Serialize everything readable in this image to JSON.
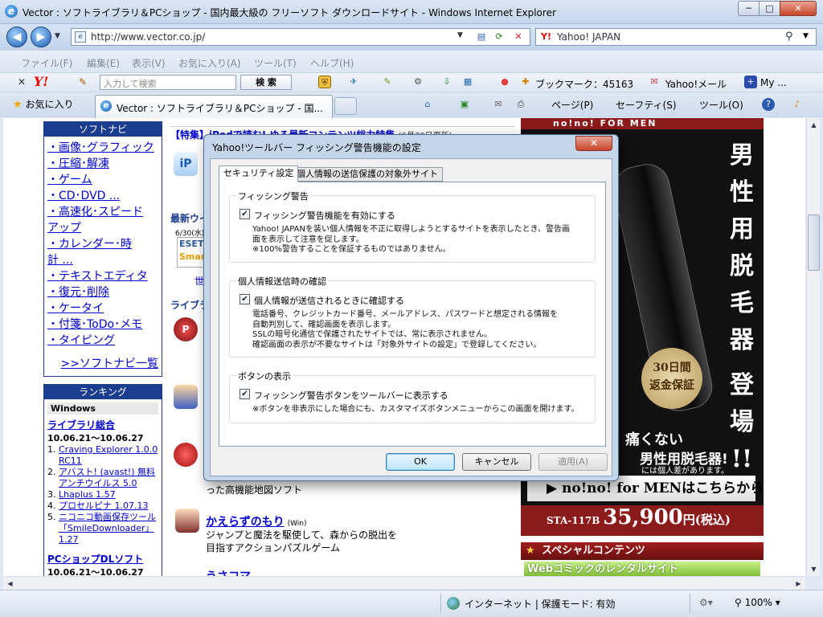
{
  "window": {
    "title": "Vector : ソフトライブラリ＆PCショップ - 国内最大級の フリーソフト ダウンロードサイト - Windows Internet Explorer",
    "min": "─",
    "max": "□",
    "close": "✕"
  },
  "address": {
    "url": "http://www.vector.co.jp/",
    "search_provider": "Yahoo! JAPAN"
  },
  "menu": [
    "ファイル(F)",
    "編集(E)",
    "表示(V)",
    "お気に入り(A)",
    "ツール(T)",
    "ヘルプ(H)"
  ],
  "yahoo_toolbar": {
    "logo": "Y!",
    "search_placeholder": "入力して検索",
    "search_button": "検 索",
    "bookmark": "ブックマーク：45163",
    "mail": "Yahoo!メール",
    "my": "My ..."
  },
  "tabs": {
    "favorites": "お気に入り",
    "active_tab": "Vector : ソフトライブラリ＆PCショップ - 国...",
    "page_menu": "ページ(P)",
    "safety_menu": "セーフティ(S)",
    "tools_menu": "ツール(O)"
  },
  "softnavi": {
    "heading": "ソフトナビ",
    "items": [
      "画像･グラフィック",
      "圧縮･解凍",
      "ゲーム",
      "CD･DVD ...",
      "高速化･スピード",
      "アップ",
      "カレンダー･時",
      "計 ...",
      "テキストエディタ",
      "復元･削除",
      "ケータイ",
      "付箋･ToDo･メモ",
      "タイピング"
    ],
    "all_link": ">>ソフトナビ一覧"
  },
  "ranking": {
    "heading": "ランキング",
    "windows": "Windows",
    "library_title": "ライブラリ総合",
    "library_dates": "10.06.21～10.06.27",
    "items": [
      "Craving Explorer 1.0.0 RC11",
      "アバスト! (avast!) 無料アンチウイルス 5.0",
      "Lhaplus 1.57",
      "プロセルピナ 1.07.13",
      "ニコニコ動画保存ツール「SmileDownloader」1.27"
    ],
    "pcshop_title": "PCショップDLソフト",
    "pcshop_dates": "10.06.21～10.06.27"
  },
  "middle": {
    "feature": "【特集】iPodで読む! ゆる最新コンテンツ総力特集",
    "feature_date": "(6月30日更新)",
    "news": "最新ウイ",
    "news_date": "6/30(水)",
    "eset": "ESET",
    "smart": "Smar",
    "world": "世",
    "library": "ライブラ",
    "map_desc": "った高機能地図ソフト",
    "game_title": "かえらずのもり",
    "game_os": "(Win)",
    "game_desc1": "ジャンプと魔法を駆使して、森からの脱出を",
    "game_desc2": "目指すアクションパズルゲーム",
    "next_title": "うさコマ"
  },
  "ad": {
    "top": "no!no! FOR MEN",
    "vertical": [
      "男",
      "性",
      "用",
      "脱",
      "毛",
      "器",
      "",
      "登",
      "場",
      "!!"
    ],
    "badge1": "30日間",
    "badge2": "返金保証",
    "line1": "痛くない",
    "line2": "男性用脱毛器!",
    "line3": "には個人差があります。",
    "cta": "no!no! for MENはこちらから",
    "model": "STA-117B",
    "price": "35,900",
    "price_unit": "円(税込)",
    "special": "スペシャルコンテンツ",
    "webcomic": "Webコミックのレンタルサイト"
  },
  "status": {
    "zone": "インターネット | 保護モード: 有効",
    "zoom": "100%"
  },
  "dialog": {
    "title": "Yahoo!ツールバー フィッシング警告機能の設定",
    "tab_security": "セキュリティ設定",
    "tab_exclude": "個人情報の送信保護の対象外サイト",
    "group1": {
      "label": "フィッシング警告",
      "checkbox": "フィッシング警告機能を有効にする",
      "desc": [
        "Yahoo! JAPANを装い個人情報を不正に取得しようとするサイトを表示したとき、警告画",
        "面を表示して注意を促します。",
        "※100%警告することを保証するものではありません。"
      ]
    },
    "group2": {
      "label": "個人情報送信時の確認",
      "checkbox": "個人情報が送信されるときに確認する",
      "desc": [
        "電話番号、クレジットカード番号、メールアドレス、パスワードと想定される情報を",
        "自動判別して、確認画面を表示します。",
        "SSLの暗号化通信で保護されたサイトでは、常に表示されません。",
        "確認画面の表示が不要なサイトは「対象外サイトの設定」で登録してください。"
      ]
    },
    "group3": {
      "label": "ボタンの表示",
      "checkbox": "フィッシング警告ボタンをツールバーに表示する",
      "desc": [
        "※ボタンを非表示にした場合にも、カスタマイズボタンメニューからこの画面を開けます。"
      ]
    },
    "ok": "OK",
    "cancel": "キャンセル",
    "apply": "適用(A)"
  }
}
